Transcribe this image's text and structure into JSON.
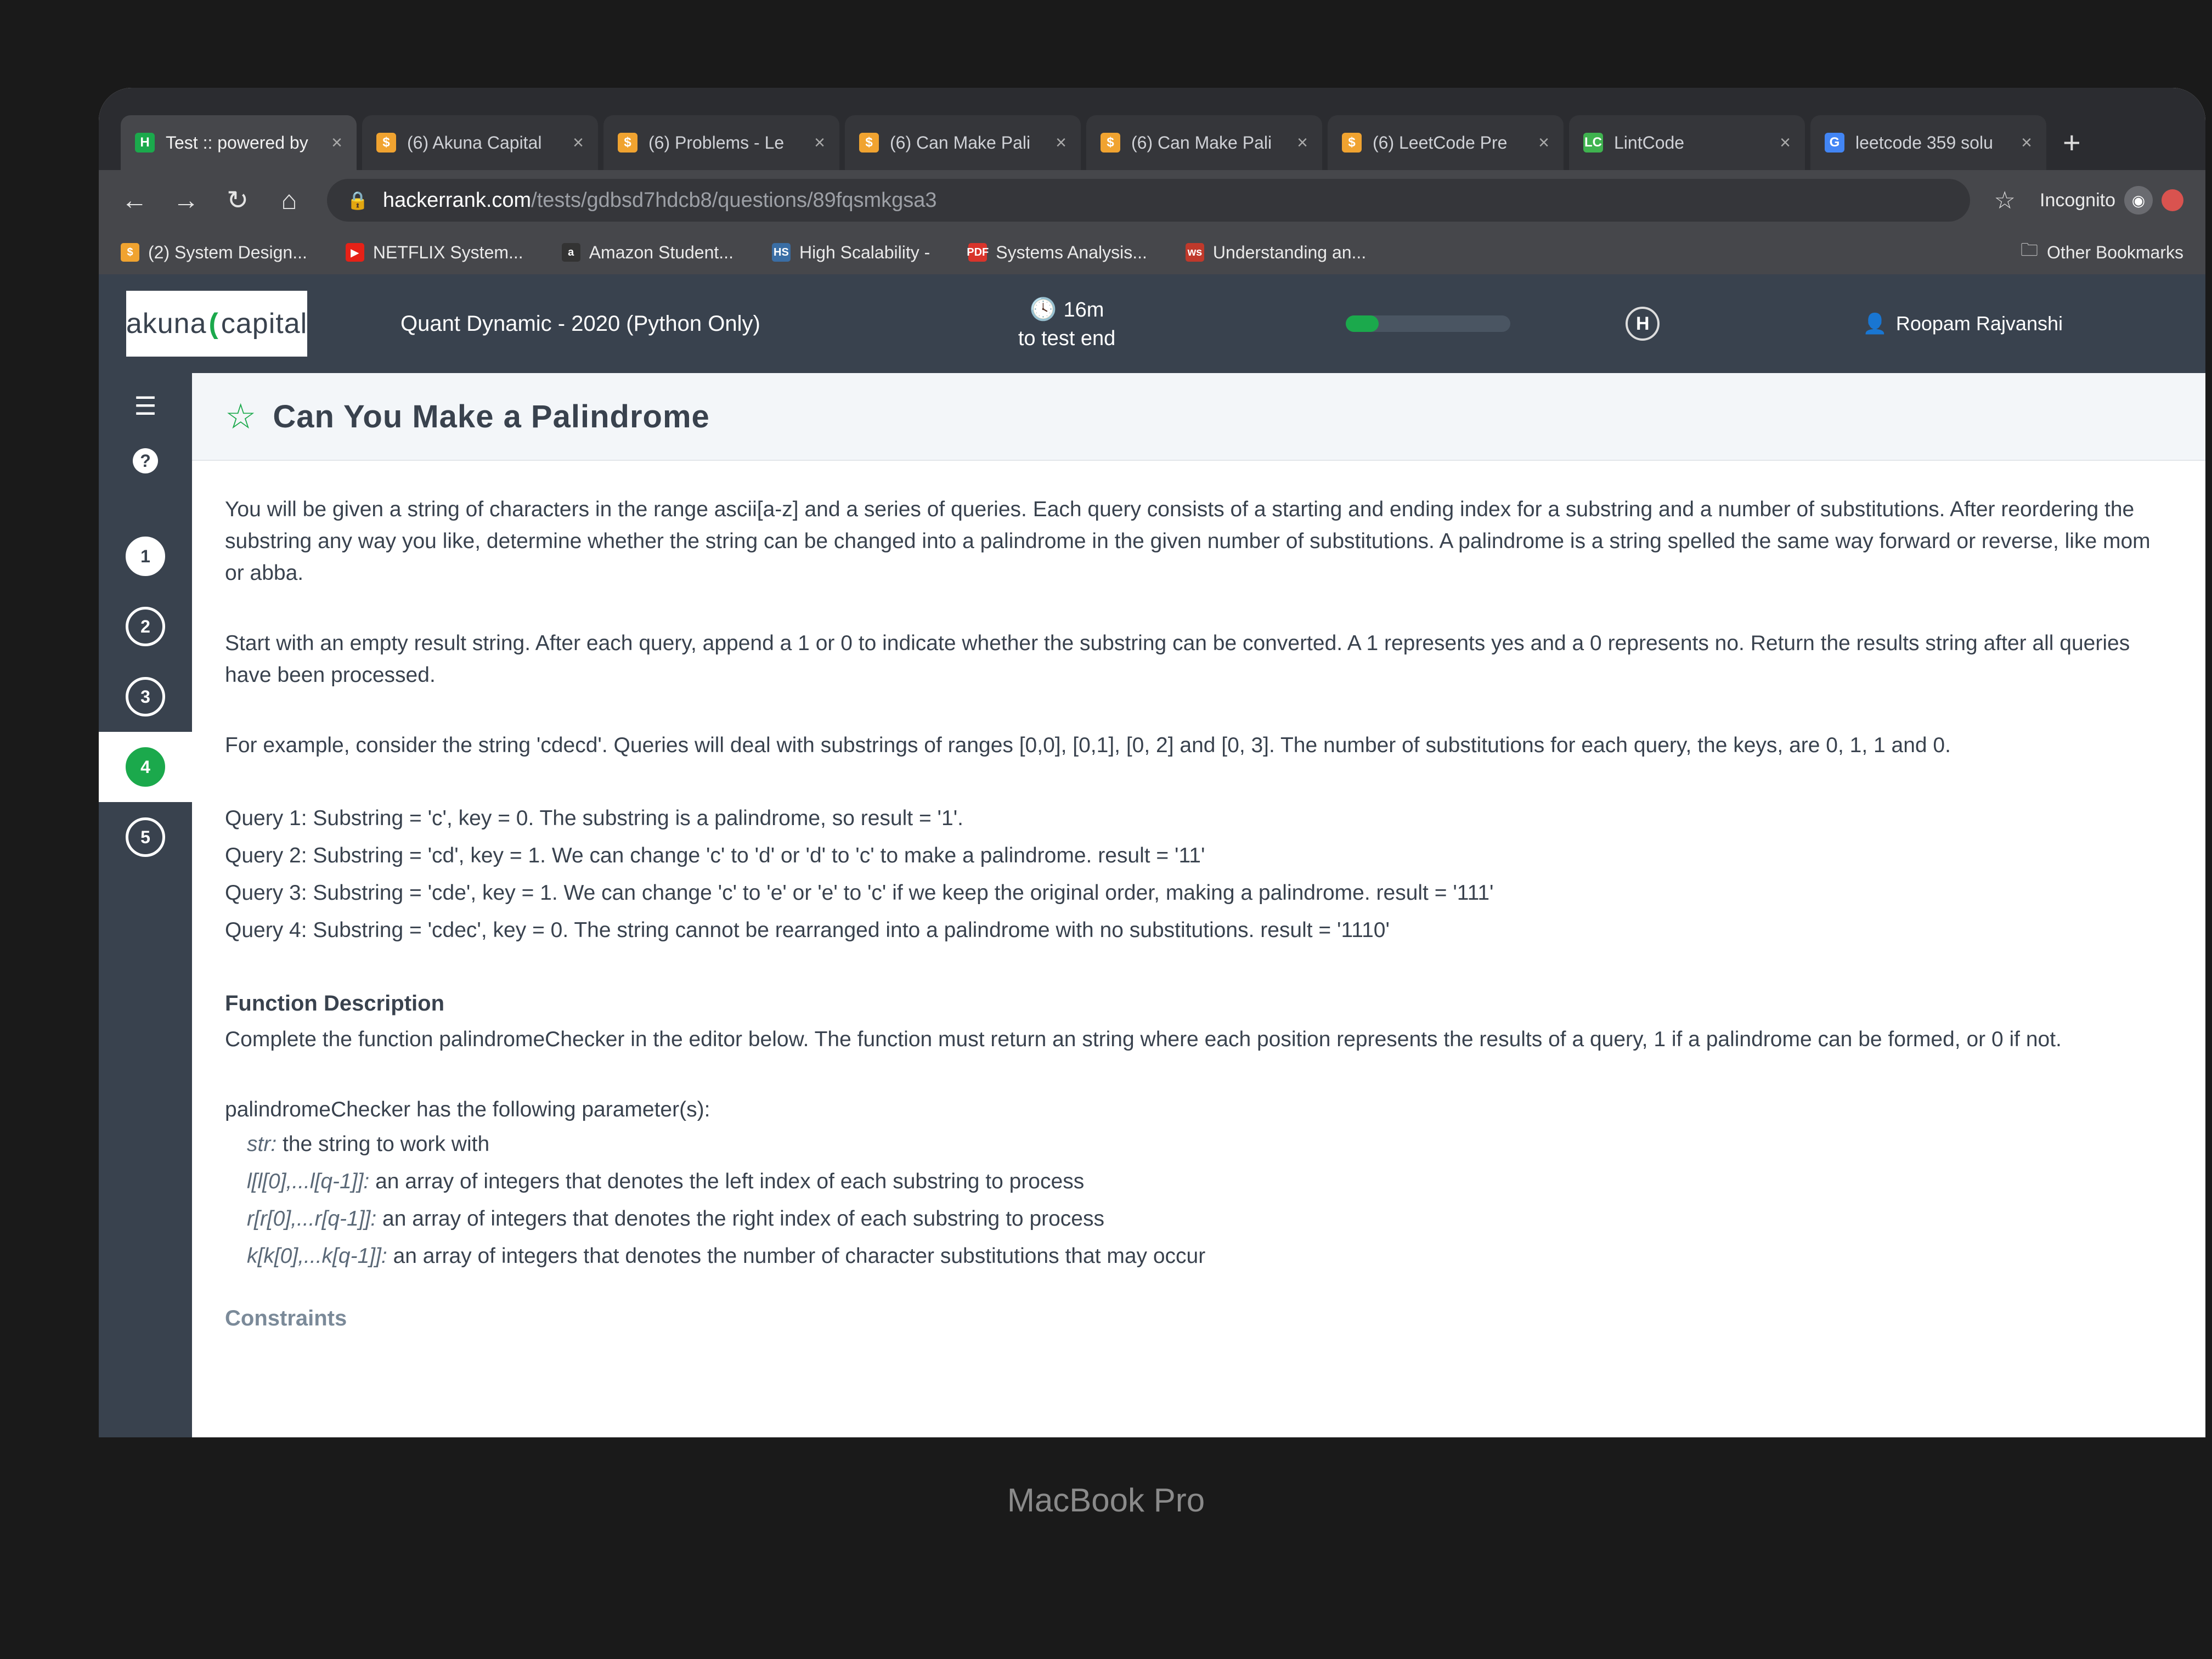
{
  "tabs": [
    {
      "label": "Test :: powered by",
      "favicon": "H",
      "favicon_color": "#1ba94c",
      "active": true
    },
    {
      "label": "(6) Akuna Capital",
      "favicon": "$",
      "favicon_color": "#f0a330",
      "active": false
    },
    {
      "label": "(6) Problems - Le",
      "favicon": "$",
      "favicon_color": "#f0a330",
      "active": false
    },
    {
      "label": "(6) Can Make Pali",
      "favicon": "$",
      "favicon_color": "#f0a330",
      "active": false
    },
    {
      "label": "(6) Can Make Pali",
      "favicon": "$",
      "favicon_color": "#f0a330",
      "active": false
    },
    {
      "label": "(6) LeetCode Pre",
      "favicon": "$",
      "favicon_color": "#f0a330",
      "active": false
    },
    {
      "label": "LintCode",
      "favicon": "LC",
      "favicon_color": "#3fb34f",
      "active": false
    },
    {
      "label": "leetcode 359 solu",
      "favicon": "G",
      "favicon_color": "#4285f4",
      "active": false
    }
  ],
  "toolbar": {
    "url_host": "hackerrank.com",
    "url_path": "/tests/gdbsd7hdcb8/questions/89fqsmkgsa3",
    "incognito_label": "Incognito"
  },
  "bookmarks": [
    {
      "label": "(2) System Design...",
      "icon": "$",
      "color": "#f0a330"
    },
    {
      "label": "NETFLIX System...",
      "icon": "▶",
      "color": "#e62117"
    },
    {
      "label": "Amazon Student...",
      "icon": "a",
      "color": "#333333"
    },
    {
      "label": "High Scalability -",
      "icon": "HS",
      "color": "#3a6ea5"
    },
    {
      "label": "Systems Analysis...",
      "icon": "PDF",
      "color": "#d9342b"
    },
    {
      "label": "Understanding an...",
      "icon": "ws",
      "color": "#c0392b"
    }
  ],
  "other_bookmarks": "Other Bookmarks",
  "header": {
    "logo_left": "akuna",
    "logo_right": "capital",
    "test_name": "Quant Dynamic - 2020 (Python Only)",
    "timer_value": "16m",
    "timer_caption": "to test end",
    "progress_fraction": 0.2,
    "user_name": "Roopam Rajvanshi"
  },
  "sidebar": {
    "questions": [
      {
        "num": "1",
        "state": "done"
      },
      {
        "num": "2",
        "state": "open"
      },
      {
        "num": "3",
        "state": "open"
      },
      {
        "num": "4",
        "state": "current"
      },
      {
        "num": "5",
        "state": "open"
      }
    ]
  },
  "problem": {
    "title": "Can You Make a Palindrome",
    "intro": "You will be given a string of characters in the range ascii[a-z] and a series of queries.  Each query consists of a starting and ending index for a substring and a number of substitutions.  After reordering the substring any way you like, determine whether the string can be changed into a palindrome in the given number of substitutions. A palindrome is a string spelled the same way forward or reverse, like mom or abba.",
    "start": "Start with an empty result string.  After each query, append a 1 or 0 to indicate whether the substring can be converted.  A 1 represents yes and a 0 represents no.  Return the results string after all queries have been processed.",
    "example": "For example, consider the string 'cdecd'.  Queries will deal with substrings of ranges [0,0], [0,1], [0, 2] and [0, 3].  The number of substitutions for each query, the keys, are 0, 1, 1 and 0.",
    "queries": [
      "Query 1: Substring = 'c', key = 0.  The substring is a palindrome, so result = '1'.",
      "Query 2: Substring = 'cd', key = 1.  We can change 'c' to 'd' or 'd' to 'c' to make a palindrome.  result = '11'",
      "Query 3: Substring = 'cde', key = 1.  We can change 'c' to 'e' or 'e' to 'c' if we keep the original order, making a palindrome.  result = '111'",
      "Query 4: Substring = 'cdec', key = 0.  The string cannot be rearranged into a palindrome with no substitutions.  result = '1110'"
    ],
    "function_heading": "Function Description",
    "function_desc": "Complete the function palindromeChecker in the editor below. The function must return an string where each position represents the results of a query, 1 if a palindrome can be formed, or 0 if not.",
    "params_intro": "palindromeChecker has the following parameter(s):",
    "params": [
      {
        "name": "str:",
        "desc": " the string to work with"
      },
      {
        "name": "l[l[0],...l[q-1]]:",
        "desc": "  an array of integers that denotes the left index of each substring to process"
      },
      {
        "name": "r[r[0],...r[q-1]]:",
        "desc": "  an array of integers that denotes the right index of each substring to process"
      },
      {
        "name": "k[k[0],...k[q-1]]:",
        "desc": "  an array of integers that denotes the number of character substitutions that may occur"
      }
    ],
    "constraints_heading": "Constraints"
  },
  "device_label": "MacBook Pro"
}
